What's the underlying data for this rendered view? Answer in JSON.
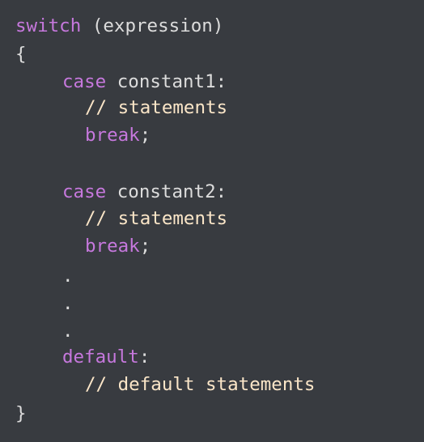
{
  "code": {
    "line1": {
      "keyword": "switch",
      "rest": " (expression)"
    },
    "line2": {
      "text": "{"
    },
    "case1": {
      "keyword": "case",
      "rest": " constant1:"
    },
    "case1_comment": {
      "text": "// statements"
    },
    "case1_break": {
      "keyword": "break",
      "punct": ";"
    },
    "case2": {
      "keyword": "case",
      "rest": " constant2:"
    },
    "case2_comment": {
      "text": "// statements"
    },
    "case2_break": {
      "keyword": "break",
      "punct": ";"
    },
    "dot1": {
      "text": "."
    },
    "dot2": {
      "text": "."
    },
    "dot3": {
      "text": "."
    },
    "default": {
      "keyword": "default",
      "punct": ":"
    },
    "default_comment": {
      "text": "// default statements"
    },
    "closing": {
      "text": "}"
    }
  },
  "colors": {
    "background": "#383b40",
    "keyword": "#c678dd",
    "plain": "#dcdcdc",
    "comment": "#fbe6c8"
  }
}
